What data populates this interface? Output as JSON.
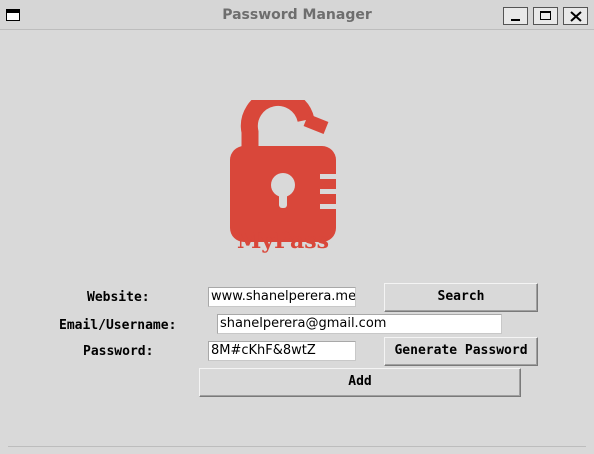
{
  "window": {
    "title": "Password Manager"
  },
  "logo": {
    "text": "MyPass",
    "color": "#d9473a"
  },
  "form": {
    "website_label": "Website:",
    "website_value": "www.shanelperera.me",
    "email_label": "Email/Username:",
    "email_value": "shanelperera@gmail.com",
    "password_label": "Password:",
    "password_value": "8M#cKhF&8wtZ",
    "search_label": "Search",
    "generate_label": "Generate Password",
    "add_label": "Add"
  },
  "icons": {
    "window": "window-icon",
    "minimize": "minimize-icon",
    "maximize": "maximize-icon",
    "close": "close-icon"
  }
}
